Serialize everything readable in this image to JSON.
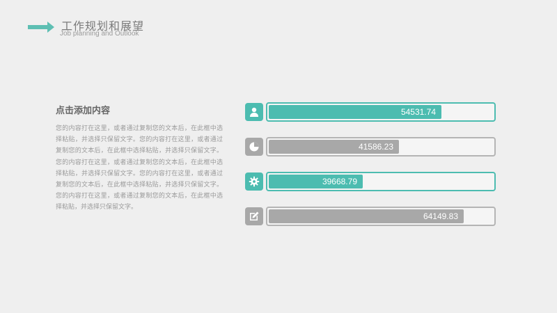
{
  "header": {
    "title": "工作规划和展望",
    "subtitle": "Job planning and Outlook"
  },
  "content": {
    "heading": "点击添加内容",
    "body": "您的内容打在这里，或者通过复制您的文本后，在此框中选择粘贴，并选择只保留文字。您的内容打在这里，或者通过复制您的文本后，在此框中选择粘贴，并选择只保留文字。您的内容打在这里，或者通过复制您的文本后，在此框中选择粘贴，并选择只保留文字。您的内容打在这里，或者通过复制您的文本后，在此框中选择粘贴，并选择只保留文字。您的内容打在这里，或者通过复制您的文本后，在此框中选择粘贴，并选择只保留文字。"
  },
  "colors": {
    "teal": "#4cbcb0",
    "gray": "#a8a8a8",
    "arrow": "#5ebfb3"
  },
  "bars": [
    {
      "label": "54531.74",
      "icon": "user-icon",
      "color": "teal",
      "fill": 0.77
    },
    {
      "label": "41586.23",
      "icon": "pie-chart-icon",
      "color": "gray",
      "fill": 0.58
    },
    {
      "label": "39668.79",
      "icon": "gear-icon",
      "color": "teal",
      "fill": 0.42
    },
    {
      "label": "64149.83",
      "icon": "edit-icon",
      "color": "gray",
      "fill": 0.87
    }
  ]
}
